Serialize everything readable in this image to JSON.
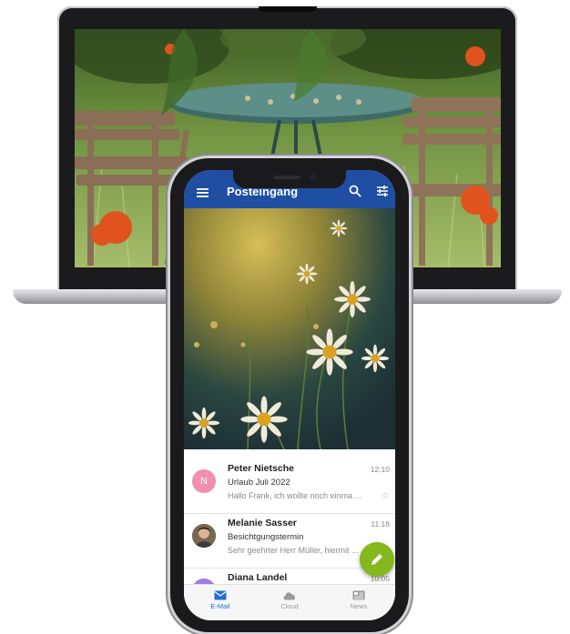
{
  "app": {
    "title": "Posteingang"
  },
  "mails": [
    {
      "avatar_letter": "N",
      "avatar_color": "#f08fb0",
      "sender": "Peter Nietsche",
      "subject": "Urlaub Juli 2022",
      "preview": "Hallo Frank, ich wollte noch einma ...",
      "time": "12:10",
      "starred": false
    },
    {
      "avatar_letter": "",
      "avatar_color": "#6b5a44",
      "sender": "Melanie Sasser",
      "subject": "Besichtgungstermin",
      "preview": "Sehr geehrter Herr Müller, hiermit ...",
      "time": "11:18",
      "starred": false
    },
    {
      "avatar_letter": "",
      "avatar_color": "#a07be0",
      "sender": "Diana Landel",
      "subject": "",
      "preview": "",
      "time": "10:05",
      "starred": false
    }
  ],
  "bottom_nav": [
    {
      "label": "E-Mail",
      "icon": "mail-icon",
      "active": true
    },
    {
      "label": "Cloud",
      "icon": "cloud-icon",
      "active": false
    },
    {
      "label": "News",
      "icon": "news-icon",
      "active": false
    }
  ],
  "colors": {
    "appbar": "#1f4ea3",
    "fab": "#84b81c",
    "active_nav": "#1f6fd6"
  }
}
